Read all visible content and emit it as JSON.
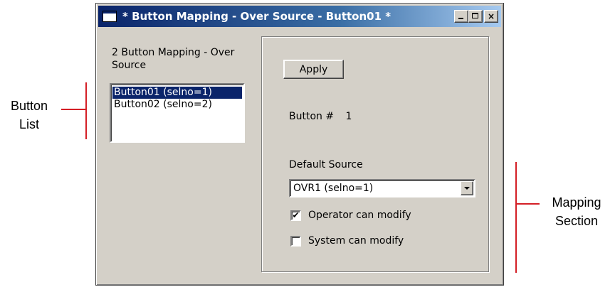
{
  "window": {
    "title": "* Button Mapping - Over Source - Button01 *",
    "controls": {
      "minimize": "minimize",
      "maximize": "maximize",
      "close": "×"
    }
  },
  "left": {
    "heading": "2 Button Mapping - Over Source",
    "list": [
      {
        "label": "Button01 (selno=1)",
        "selected": true
      },
      {
        "label": "Button02 (selno=2)",
        "selected": false
      }
    ]
  },
  "mapping": {
    "apply_label": "Apply",
    "button_num_label": "Button #",
    "button_num_value": "1",
    "default_source_label": "Default Source",
    "default_source_value": "OVR1 (selno=1)",
    "operator_modify_label": "Operator can modify",
    "operator_modify_checked": true,
    "system_modify_label": "System can modify",
    "system_modify_checked": false,
    "check_glyph": "✔"
  },
  "callouts": {
    "button_list_line1": "Button",
    "button_list_line2": "List",
    "mapping_section_line1": "Mapping",
    "mapping_section_line2": "Section"
  },
  "colors": {
    "titlebar_start": "#0a246a",
    "selection": "#0a246a",
    "callout_line": "#d41f26",
    "window_face": "#d4d0c8"
  }
}
